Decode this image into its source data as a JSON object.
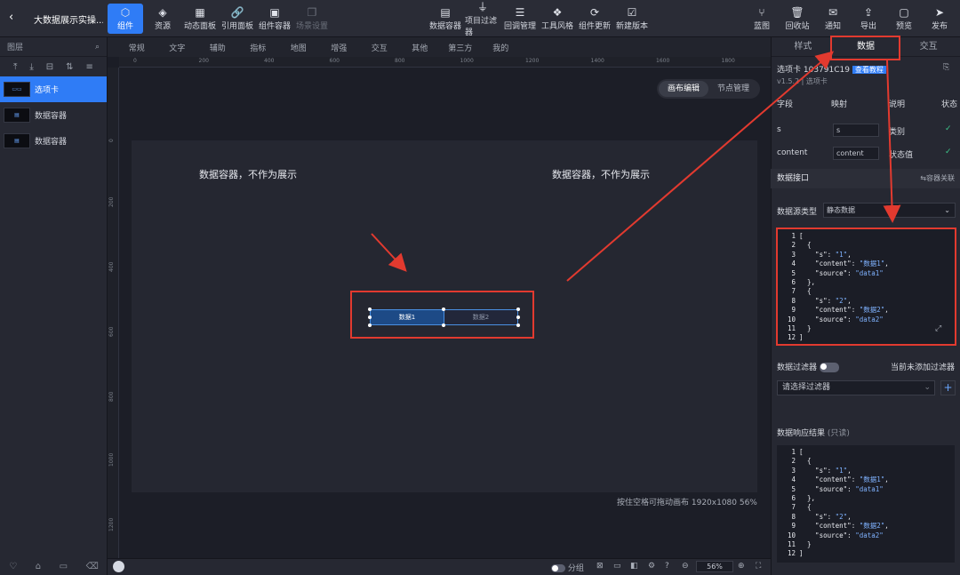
{
  "header": {
    "back_icon": "chevron-left-icon",
    "title": "大数据展示实操..."
  },
  "toolbar": {
    "left": [
      {
        "label": "组件",
        "icon": "component-icon",
        "active": true
      },
      {
        "label": "资源",
        "icon": "layers-icon"
      },
      {
        "label": "动态面板",
        "icon": "panel-icon"
      },
      {
        "label": "引用面板",
        "icon": "link-icon"
      },
      {
        "label": "组件容器",
        "icon": "container-icon"
      },
      {
        "label": "场景设置",
        "icon": "scene-icon",
        "disabled": true
      }
    ],
    "center": [
      {
        "label": "数据容器",
        "icon": "data-container-icon"
      },
      {
        "label": "项目过滤器",
        "icon": "filter-icon"
      },
      {
        "label": "回调管理",
        "icon": "sliders-icon"
      },
      {
        "label": "工具风格",
        "icon": "style-icon"
      },
      {
        "label": "组件更新",
        "icon": "refresh-icon"
      },
      {
        "label": "新建版本",
        "icon": "version-icon"
      }
    ],
    "right": [
      {
        "label": "蓝图",
        "icon": "blueprint-icon"
      },
      {
        "label": "回收站",
        "icon": "trash-icon"
      },
      {
        "label": "通知",
        "icon": "notice-icon"
      },
      {
        "label": "导出",
        "icon": "export-icon"
      },
      {
        "label": "预览",
        "icon": "preview-icon"
      },
      {
        "label": "发布",
        "icon": "publish-icon"
      }
    ]
  },
  "layers": {
    "title": "图层",
    "search_icon": "search-icon",
    "items": [
      {
        "label": "选项卡",
        "active": true
      },
      {
        "label": "数据容器"
      },
      {
        "label": "数据容器"
      }
    ]
  },
  "tabs": [
    "常规",
    "文字",
    "辅助",
    "指标",
    "地图",
    "增强",
    "交互",
    "其他",
    "第三方",
    "我的"
  ],
  "ruler": {
    "h": [
      "0",
      "200",
      "400",
      "600",
      "800",
      "1000",
      "1200",
      "1400",
      "1600",
      "1800"
    ],
    "v": [
      "0",
      "200",
      "400",
      "600",
      "800",
      "1000",
      "1200"
    ]
  },
  "canvas": {
    "mode": [
      "画布编辑",
      "节点管理"
    ],
    "text1": "数据容器，不作为展示",
    "text2": "数据容器，不作为展示",
    "widget": [
      "数据1",
      "数据2"
    ],
    "hint": "按住空格可拖动画布   1920x1080  56%"
  },
  "bottom": {
    "toggle_label": "分组",
    "zoom": "56%"
  },
  "right": {
    "tabs": [
      "样式",
      "数据",
      "交互"
    ],
    "active_tab": "数据",
    "component_name": "选项卡 103791C19",
    "tutorial": "查看教程",
    "version": "v1.5.2 | 选项卡",
    "table_headers": [
      "字段",
      "映射",
      "说明",
      "状态"
    ],
    "fields": [
      {
        "field": "s",
        "map": "s",
        "desc": "类别"
      },
      {
        "field": "content",
        "map": "content",
        "desc": "状态值"
      }
    ],
    "interface_title": "数据接口",
    "interface_action": "⇆容器关联",
    "source_type_label": "数据源类型",
    "source_type_value": "静态数据",
    "filter_label": "数据过滤器",
    "filter_hint": "当前未添加过滤器",
    "filter_placeholder": "请选择过滤器",
    "result_title": "数据响应结果",
    "result_note": "(只读)",
    "code_lines": [
      "[",
      "  {",
      "    \"s\": \"1\",",
      "    \"content\": \"数据1\",",
      "    \"source\": \"data1\"",
      "  },",
      "  {",
      "    \"s\": \"2\",",
      "    \"content\": \"数据2\",",
      "    \"source\": \"data2\"",
      "  }",
      "]"
    ]
  },
  "colors": {
    "accent": "#2f7cf6",
    "annotation": "#e23a2f",
    "ok": "#3cc68a"
  }
}
